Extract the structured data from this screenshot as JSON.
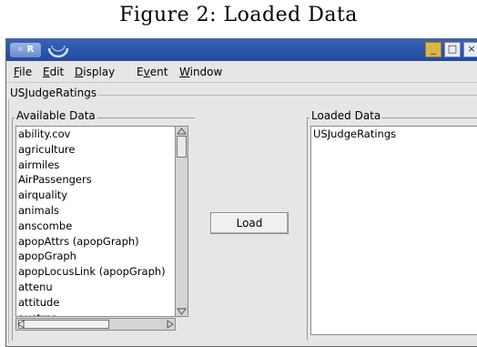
{
  "figure_caption": "Figure 2: Loaded Data",
  "window": {
    "app_icon_label": "R",
    "controls": {
      "minimize": "_",
      "maximize": "□",
      "close": "×"
    }
  },
  "menubar": {
    "items": [
      {
        "label": "File",
        "accel": "F"
      },
      {
        "label": "Edit",
        "accel": "E"
      },
      {
        "label": "Display",
        "accel": "D"
      },
      {
        "label": "Event",
        "accel": "v"
      },
      {
        "label": "Window",
        "accel": "W"
      }
    ]
  },
  "dataset_group_label": "USJudgeRatings",
  "available_panel": {
    "label": "Available Data",
    "items": [
      "ability.cov",
      "agriculture",
      "airmiles",
      "AirPassengers",
      "airquality",
      "animals",
      "anscombe",
      "apopAttrs (apopGraph)",
      "apopGraph",
      "apopLocusLink (apopGraph)",
      "attenu",
      "attitude",
      "austres"
    ]
  },
  "load_button_label": "Load",
  "loaded_panel": {
    "label": "Loaded Data",
    "items": [
      "USJudgeRatings"
    ]
  }
}
